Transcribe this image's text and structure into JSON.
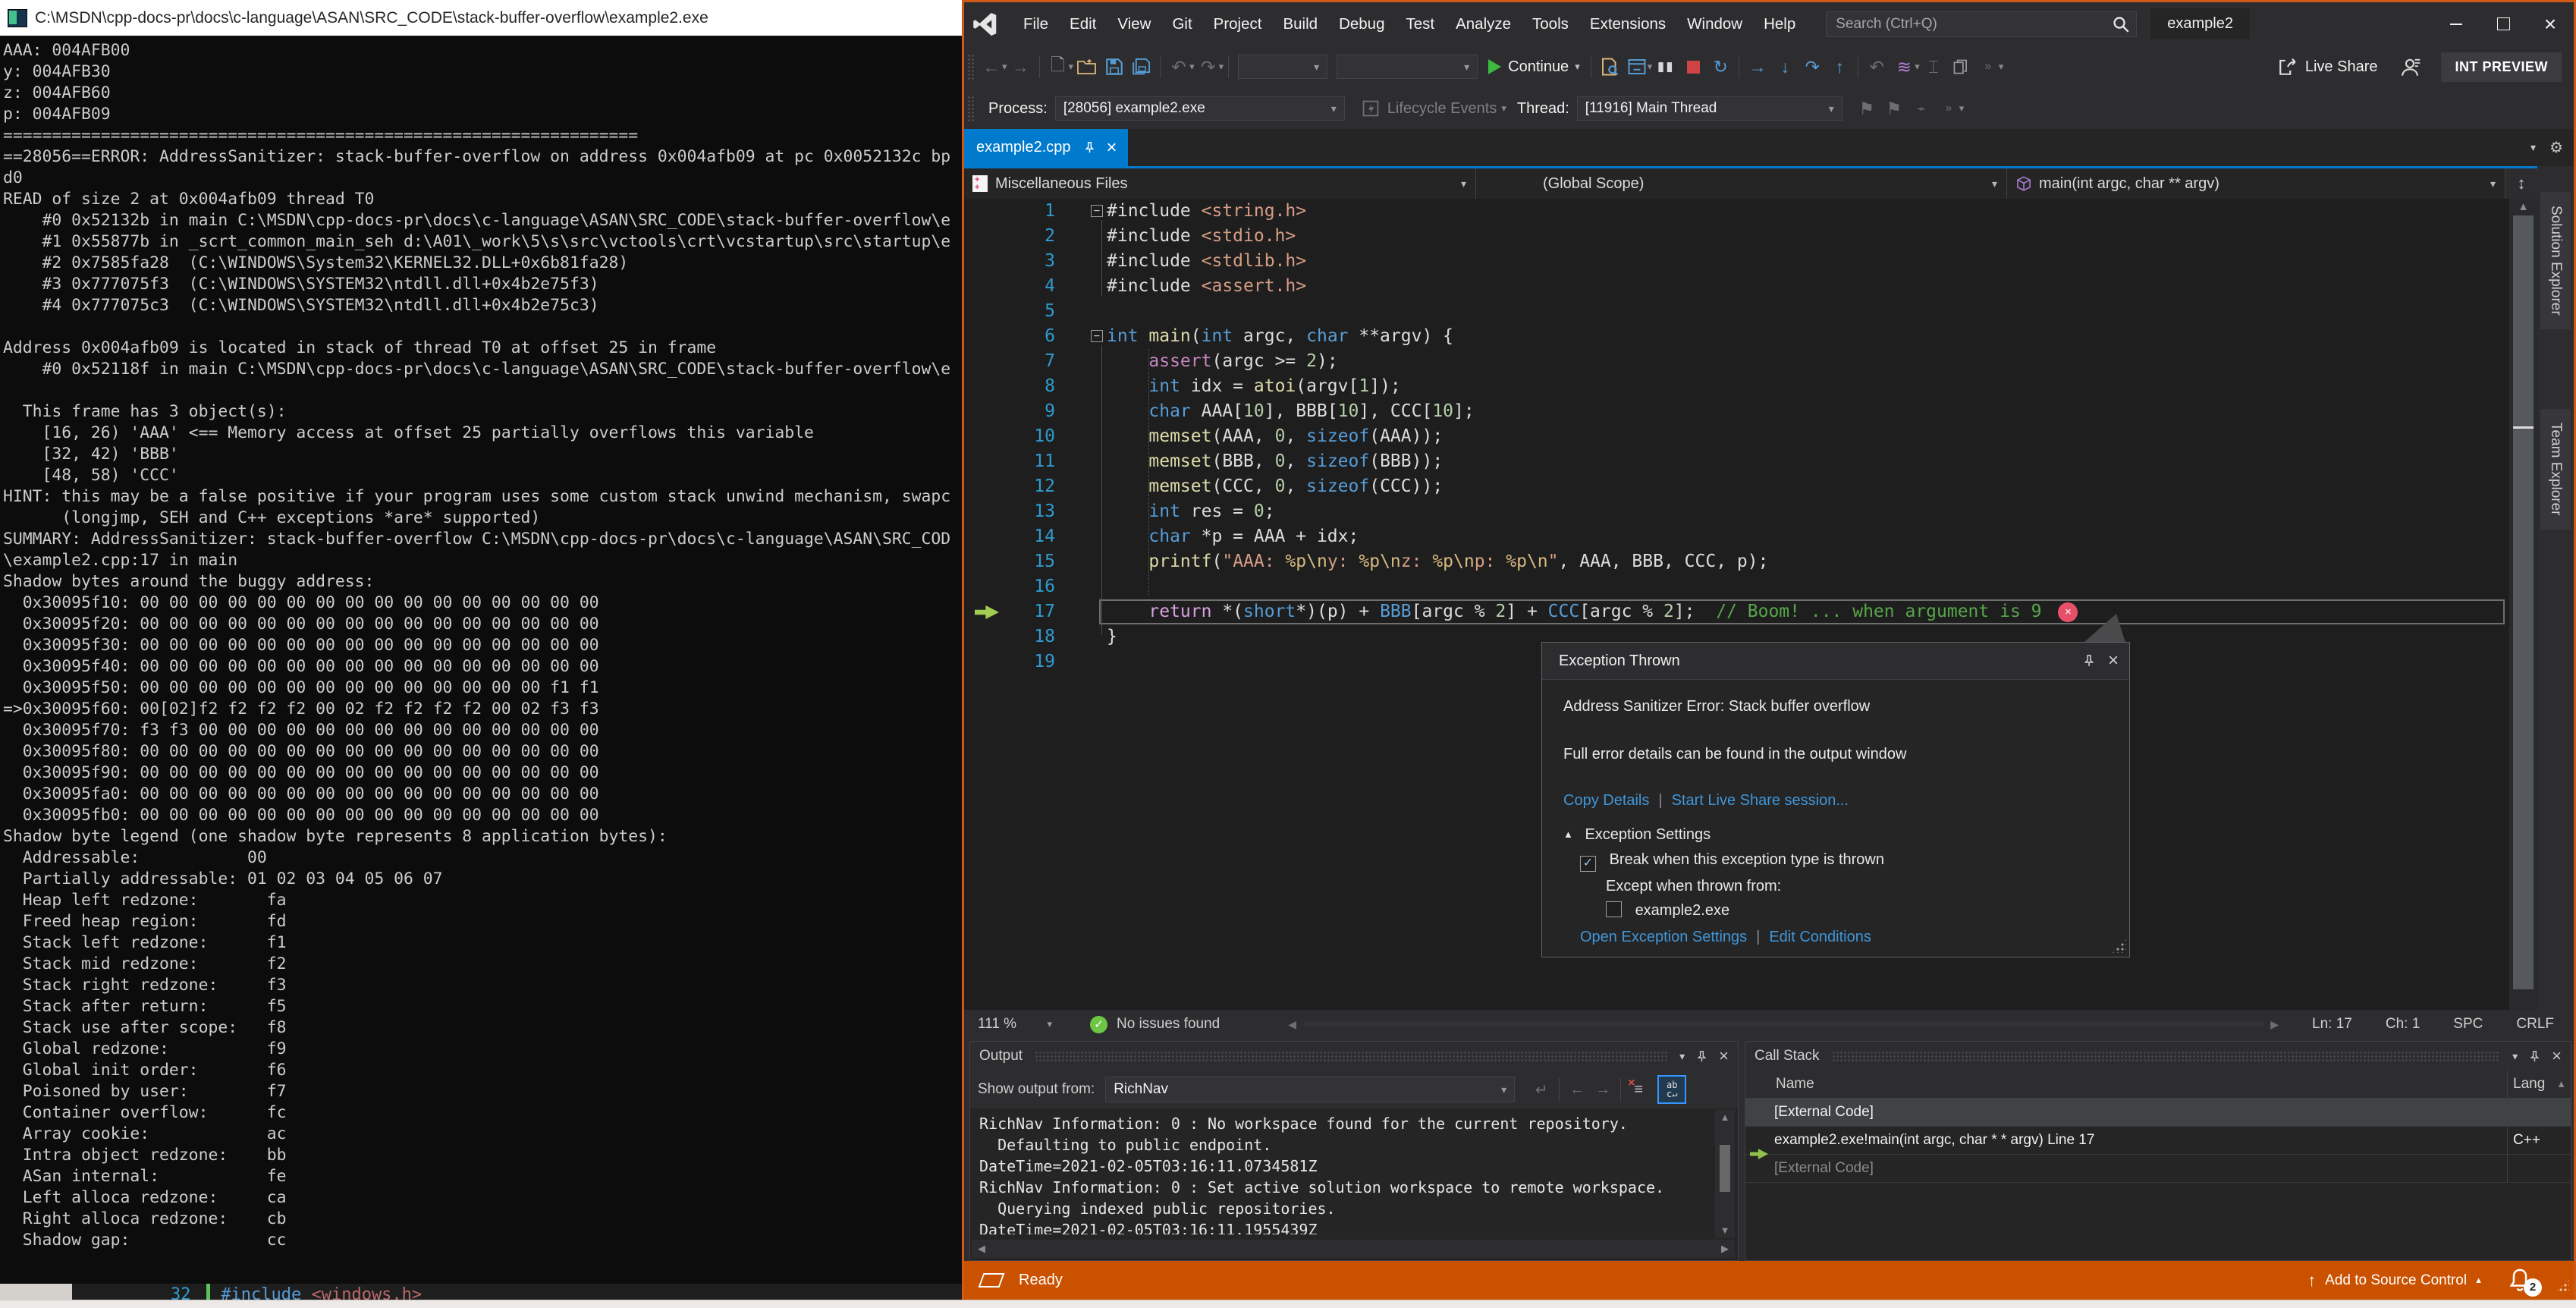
{
  "console": {
    "title": "C:\\MSDN\\cpp-docs-pr\\docs\\c-language\\ASAN\\SRC_CODE\\stack-buffer-overflow\\example2.exe",
    "lines": [
      "AAA: 004AFB00",
      "y: 004AFB30",
      "z: 004AFB60",
      "p: 004AFB09",
      "=================================================================",
      "==28056==ERROR: AddressSanitizer: stack-buffer-overflow on address 0x004afb09 at pc 0x0052132c bp",
      "d0",
      "READ of size 2 at 0x004afb09 thread T0",
      "    #0 0x52132b in main C:\\MSDN\\cpp-docs-pr\\docs\\c-language\\ASAN\\SRC_CODE\\stack-buffer-overflow\\e",
      "    #1 0x55877b in _scrt_common_main_seh d:\\A01\\_work\\5\\s\\src\\vctools\\crt\\vcstartup\\src\\startup\\e",
      "    #2 0x7585fa28  (C:\\WINDOWS\\System32\\KERNEL32.DLL+0x6b81fa28)",
      "    #3 0x777075f3  (C:\\WINDOWS\\SYSTEM32\\ntdll.dll+0x4b2e75f3)",
      "    #4 0x777075c3  (C:\\WINDOWS\\SYSTEM32\\ntdll.dll+0x4b2e75c3)",
      "",
      "Address 0x004afb09 is located in stack of thread T0 at offset 25 in frame",
      "    #0 0x52118f in main C:\\MSDN\\cpp-docs-pr\\docs\\c-language\\ASAN\\SRC_CODE\\stack-buffer-overflow\\e",
      "",
      "  This frame has 3 object(s):",
      "    [16, 26) 'AAA' <== Memory access at offset 25 partially overflows this variable",
      "    [32, 42) 'BBB'",
      "    [48, 58) 'CCC'",
      "HINT: this may be a false positive if your program uses some custom stack unwind mechanism, swapc",
      "      (longjmp, SEH and C++ exceptions *are* supported)",
      "SUMMARY: AddressSanitizer: stack-buffer-overflow C:\\MSDN\\cpp-docs-pr\\docs\\c-language\\ASAN\\SRC_COD",
      "\\example2.cpp:17 in main",
      "Shadow bytes around the buggy address:",
      "  0x30095f10: 00 00 00 00 00 00 00 00 00 00 00 00 00 00 00 00",
      "  0x30095f20: 00 00 00 00 00 00 00 00 00 00 00 00 00 00 00 00",
      "  0x30095f30: 00 00 00 00 00 00 00 00 00 00 00 00 00 00 00 00",
      "  0x30095f40: 00 00 00 00 00 00 00 00 00 00 00 00 00 00 00 00",
      "  0x30095f50: 00 00 00 00 00 00 00 00 00 00 00 00 00 00 f1 f1",
      "=>0x30095f60: 00[02]f2 f2 f2 f2 00 02 f2 f2 f2 f2 00 02 f3 f3",
      "  0x30095f70: f3 f3 00 00 00 00 00 00 00 00 00 00 00 00 00 00",
      "  0x30095f80: 00 00 00 00 00 00 00 00 00 00 00 00 00 00 00 00",
      "  0x30095f90: 00 00 00 00 00 00 00 00 00 00 00 00 00 00 00 00",
      "  0x30095fa0: 00 00 00 00 00 00 00 00 00 00 00 00 00 00 00 00",
      "  0x30095fb0: 00 00 00 00 00 00 00 00 00 00 00 00 00 00 00 00",
      "Shadow byte legend (one shadow byte represents 8 application bytes):",
      "  Addressable:           00",
      "  Partially addressable: 01 02 03 04 05 06 07",
      "  Heap left redzone:       fa",
      "  Freed heap region:       fd",
      "  Stack left redzone:      f1",
      "  Stack mid redzone:       f2",
      "  Stack right redzone:     f3",
      "  Stack after return:      f5",
      "  Stack use after scope:   f8",
      "  Global redzone:          f9",
      "  Global init order:       f6",
      "  Poisoned by user:        f7",
      "  Container overflow:      fc",
      "  Array cookie:            ac",
      "  Intra object redzone:    bb",
      "  ASan internal:           fe",
      "  Left alloca redzone:     ca",
      "  Right alloca redzone:    cb",
      "  Shadow gap:              cc"
    ]
  },
  "behind": {
    "line_no": "32",
    "include": "#include ",
    "header": "<windows.h>"
  },
  "vs": {
    "titlebar": {
      "menus": [
        "File",
        "Edit",
        "View",
        "Git",
        "Project",
        "Build",
        "Debug",
        "Test",
        "Analyze",
        "Tools",
        "Extensions",
        "Window",
        "Help"
      ],
      "search_placeholder": "Search (Ctrl+Q)",
      "window_title": "example2"
    },
    "toolbar": {
      "continue_label": "Continue",
      "live_share_label": "Live Share",
      "int_preview_label": "INT PREVIEW"
    },
    "debugbar": {
      "process_label": "Process:",
      "process_value": "[28056] example2.exe",
      "lifecycle_label": "Lifecycle Events",
      "thread_label": "Thread:",
      "thread_value": "[11916] Main Thread"
    },
    "tab": {
      "label": "example2.cpp"
    },
    "navbar": {
      "project": "Miscellaneous Files",
      "scope": "(Global Scope)",
      "member": "main(int argc, char ** argv)"
    },
    "editor": {
      "palette": {
        "k": "#569cd6",
        "f": "#dcdcaa",
        "m": "#c586c0",
        "i": "#dcdcdc",
        "n": "#b5cea8",
        "s": "#d69d85",
        "e": "#d7ba7d",
        "g": "#57a64a",
        "r": "#d8a0df",
        "b": "#569cd6"
      },
      "lines": [
        {
          "n": 1,
          "fold": true,
          "seg": [
            [
              "i",
              "#include "
            ],
            [
              "s",
              "<string.h>"
            ]
          ]
        },
        {
          "n": 2,
          "seg": [
            [
              "i",
              "#include "
            ],
            [
              "s",
              "<stdio.h>"
            ]
          ]
        },
        {
          "n": 3,
          "seg": [
            [
              "i",
              "#include "
            ],
            [
              "s",
              "<stdlib.h>"
            ]
          ]
        },
        {
          "n": 4,
          "seg": [
            [
              "i",
              "#include "
            ],
            [
              "s",
              "<assert.h>"
            ]
          ]
        },
        {
          "n": 5,
          "seg": []
        },
        {
          "n": 6,
          "fold": true,
          "seg": [
            [
              "k",
              "int "
            ],
            [
              "f",
              "main"
            ],
            [
              "i",
              "("
            ],
            [
              "k",
              "int"
            ],
            [
              "i",
              " argc, "
            ],
            [
              "k",
              "char"
            ],
            [
              "i",
              " **argv) {"
            ]
          ]
        },
        {
          "n": 7,
          "seg": [
            [
              "i",
              "    "
            ],
            [
              "m",
              "assert"
            ],
            [
              "i",
              "(argc >= "
            ],
            [
              "n",
              "2"
            ],
            [
              "i",
              ");"
            ]
          ]
        },
        {
          "n": 8,
          "seg": [
            [
              "i",
              "    "
            ],
            [
              "k",
              "int"
            ],
            [
              "i",
              " idx = "
            ],
            [
              "f",
              "atoi"
            ],
            [
              "i",
              "(argv["
            ],
            [
              "n",
              "1"
            ],
            [
              "i",
              "]);"
            ]
          ]
        },
        {
          "n": 9,
          "seg": [
            [
              "i",
              "    "
            ],
            [
              "k",
              "char"
            ],
            [
              "i",
              " AAA["
            ],
            [
              "n",
              "10"
            ],
            [
              "i",
              "], BBB["
            ],
            [
              "n",
              "10"
            ],
            [
              "i",
              "], CCC["
            ],
            [
              "n",
              "10"
            ],
            [
              "i",
              "];"
            ]
          ]
        },
        {
          "n": 10,
          "seg": [
            [
              "i",
              "    "
            ],
            [
              "f",
              "memset"
            ],
            [
              "i",
              "(AAA, "
            ],
            [
              "n",
              "0"
            ],
            [
              "i",
              ", "
            ],
            [
              "k",
              "sizeof"
            ],
            [
              "i",
              "(AAA));"
            ]
          ]
        },
        {
          "n": 11,
          "seg": [
            [
              "i",
              "    "
            ],
            [
              "f",
              "memset"
            ],
            [
              "i",
              "(BBB, "
            ],
            [
              "n",
              "0"
            ],
            [
              "i",
              ", "
            ],
            [
              "k",
              "sizeof"
            ],
            [
              "i",
              "(BBB));"
            ]
          ]
        },
        {
          "n": 12,
          "seg": [
            [
              "i",
              "    "
            ],
            [
              "f",
              "memset"
            ],
            [
              "i",
              "(CCC, "
            ],
            [
              "n",
              "0"
            ],
            [
              "i",
              ", "
            ],
            [
              "k",
              "sizeof"
            ],
            [
              "i",
              "(CCC));"
            ]
          ]
        },
        {
          "n": 13,
          "seg": [
            [
              "i",
              "    "
            ],
            [
              "k",
              "int"
            ],
            [
              "i",
              " res = "
            ],
            [
              "n",
              "0"
            ],
            [
              "i",
              ";"
            ]
          ]
        },
        {
          "n": 14,
          "seg": [
            [
              "i",
              "    "
            ],
            [
              "k",
              "char"
            ],
            [
              "i",
              " *p = AAA + idx;"
            ]
          ]
        },
        {
          "n": 15,
          "seg": [
            [
              "i",
              "    "
            ],
            [
              "f",
              "printf"
            ],
            [
              "i",
              "("
            ],
            [
              "s",
              "\"AAA: "
            ],
            [
              "e",
              "%p\\n"
            ],
            [
              "s",
              "y: "
            ],
            [
              "e",
              "%p\\n"
            ],
            [
              "s",
              "z: "
            ],
            [
              "e",
              "%p\\n"
            ],
            [
              "s",
              "p: "
            ],
            [
              "e",
              "%p\\n"
            ],
            [
              "s",
              "\""
            ],
            [
              "i",
              ", AAA, BBB, CCC, p);"
            ]
          ]
        },
        {
          "n": 16,
          "seg": []
        },
        {
          "n": 17,
          "current": true,
          "error": true,
          "seg": [
            [
              "i",
              "    "
            ],
            [
              "r",
              "return"
            ],
            [
              "i",
              " *("
            ],
            [
              "k",
              "short"
            ],
            [
              "i",
              "*)(p) + "
            ],
            [
              "b",
              "BBB"
            ],
            [
              "i",
              "[argc % "
            ],
            [
              "n",
              "2"
            ],
            [
              "i",
              "] + "
            ],
            [
              "b",
              "CCC"
            ],
            [
              "i",
              "[argc % "
            ],
            [
              "n",
              "2"
            ],
            [
              "i",
              "];  "
            ],
            [
              "g",
              "// Boom! ... when argument is 9"
            ]
          ]
        },
        {
          "n": 18,
          "seg": [
            [
              "i",
              "}"
            ]
          ]
        },
        {
          "n": 19,
          "seg": []
        }
      ]
    },
    "exception": {
      "title": "Exception Thrown",
      "message": "Address Sanitizer Error: Stack buffer overflow",
      "details": "Full error details can be found in the output window",
      "copy_details": "Copy Details",
      "start_live_share": "Start Live Share session...",
      "settings_header": "Exception Settings",
      "break_label": "Break when this exception type is thrown",
      "except_label": "Except when thrown from:",
      "module": "example2.exe",
      "open_settings": "Open Exception Settings",
      "edit_conditions": "Edit Conditions"
    },
    "editor_status": {
      "zoom": "111 %",
      "issues": "No issues found",
      "ln": "Ln: 17",
      "ch": "Ch: 1",
      "spc": "SPC",
      "eol": "CRLF"
    },
    "output": {
      "title": "Output",
      "show_label": "Show output from:",
      "source": "RichNav",
      "lines": [
        "RichNav Information: 0 : No workspace found for the current repository.",
        "  Defaulting to public endpoint.",
        "DateTime=2021-02-05T03:16:11.0734581Z",
        "RichNav Information: 0 : Set active solution workspace to remote workspace.",
        "  Querying indexed public repositories.",
        "DateTime=2021-02-05T03:16:11.1955439Z"
      ]
    },
    "callstack": {
      "title": "Call Stack",
      "col_name": "Name",
      "col_lang": "Lang",
      "rows": [
        {
          "name": "[External Code]",
          "lang": "",
          "style": "selected"
        },
        {
          "name": "example2.exe!main(int argc, char * * argv) Line 17",
          "lang": "C++",
          "arrow": true
        },
        {
          "name": "[External Code]",
          "lang": "",
          "style": "dim"
        }
      ]
    },
    "statusbar": {
      "ready": "Ready",
      "add_source_control": "Add to Source Control",
      "badge": "2"
    },
    "side_tabs": [
      "Solution Explorer",
      "Team Explorer"
    ],
    "colors": {
      "accent": "#007acc",
      "debug_orange": "#ca5100",
      "window_border": "#cf5a17",
      "tab_active": "#007acc"
    }
  }
}
